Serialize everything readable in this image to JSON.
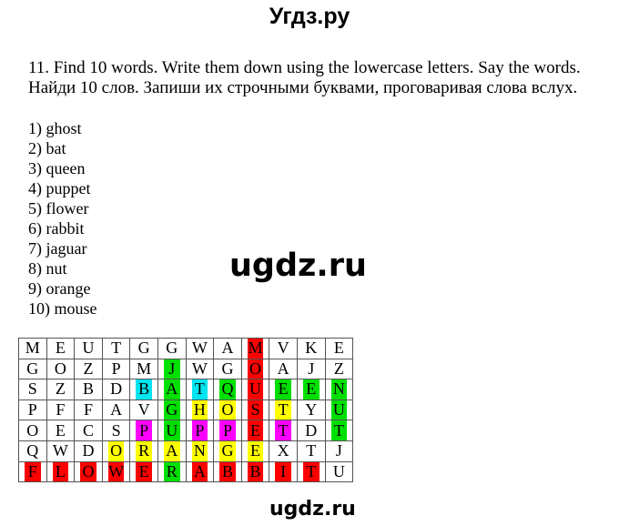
{
  "header": {
    "title": "Угдз.ру"
  },
  "task": {
    "line_en": "11. Find 10 words. Write them down using the lowercase letters. Say the words.",
    "line_ru": "Найди 10 слов. Запиши их строчными буквами, проговаривая слова вслух."
  },
  "answers": [
    "1) ghost",
    "2) bat",
    "3) queen",
    "4) puppet",
    "5) flower",
    "6) rabbit",
    "7) jaguar",
    "8) nut",
    "9) orange",
    "10) mouse"
  ],
  "watermarks": {
    "middle": "ugdz.ru",
    "bottom": "ugdz.ru"
  },
  "colors": {
    "r": "#ff0000",
    "g": "#00e000",
    "c": "#00e5f0",
    "y": "#ffff00",
    "m": "#ff00ff"
  },
  "grid": {
    "rows": [
      [
        "M",
        "E",
        "U",
        "T",
        "G",
        "G",
        "W",
        "A",
        "M",
        "V",
        "K",
        "E"
      ],
      [
        "G",
        "O",
        "Z",
        "P",
        "M",
        "J",
        "W",
        "G",
        "O",
        "A",
        "J",
        "Z"
      ],
      [
        "S",
        "Z",
        "B",
        "D",
        "B",
        "A",
        "T",
        "Q",
        "U",
        "E",
        "E",
        "N"
      ],
      [
        "P",
        "F",
        "F",
        "A",
        "V",
        "G",
        "H",
        "O",
        "S",
        "T",
        "Y",
        "U"
      ],
      [
        "O",
        "E",
        "C",
        "S",
        "P",
        "U",
        "P",
        "P",
        "E",
        "T",
        "D",
        "T"
      ],
      [
        "Q",
        "W",
        "D",
        "O",
        "R",
        "A",
        "N",
        "G",
        "E",
        "X",
        "T",
        "J"
      ],
      [
        "F",
        "L",
        "O",
        "W",
        "E",
        "R",
        "A",
        "B",
        "B",
        "I",
        "T",
        "U"
      ]
    ],
    "highlights": [
      [
        "",
        "",
        "",
        "",
        "",
        "",
        "",
        "",
        "r",
        "",
        "",
        ""
      ],
      [
        "",
        "",
        "",
        "",
        "",
        "g",
        "",
        "",
        "r",
        "",
        "",
        ""
      ],
      [
        "",
        "",
        "",
        "",
        "c",
        "g",
        "c",
        "g",
        "r",
        "g",
        "g",
        "g"
      ],
      [
        "",
        "",
        "",
        "",
        "",
        "g",
        "y",
        "y",
        "r",
        "y",
        "",
        "g"
      ],
      [
        "",
        "",
        "",
        "",
        "m",
        "g",
        "m",
        "m",
        "r",
        "m",
        "",
        "g"
      ],
      [
        "",
        "",
        "",
        "y",
        "y",
        "y",
        "y",
        "y",
        "y",
        "",
        "",
        ""
      ],
      [
        "r",
        "r",
        "r",
        "r",
        "r",
        "g",
        "r",
        "r",
        "r",
        "r",
        "r",
        ""
      ]
    ]
  }
}
